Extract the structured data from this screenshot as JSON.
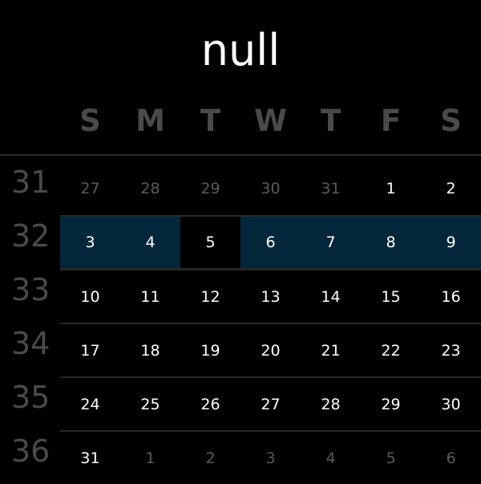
{
  "calendar": {
    "title": "null",
    "weekdays": [
      "S",
      "M",
      "T",
      "W",
      "T",
      "F",
      "S"
    ],
    "weeks": [
      {
        "week_number": "31",
        "days": [
          {
            "label": "27",
            "other_month": true
          },
          {
            "label": "28",
            "other_month": true
          },
          {
            "label": "29",
            "other_month": true
          },
          {
            "label": "30",
            "other_month": true
          },
          {
            "label": "31",
            "other_month": true
          },
          {
            "label": "1",
            "other_month": false
          },
          {
            "label": "2",
            "other_month": false
          }
        ]
      },
      {
        "week_number": "32",
        "selected": true,
        "days": [
          {
            "label": "3",
            "other_month": false
          },
          {
            "label": "4",
            "other_month": false
          },
          {
            "label": "5",
            "other_month": false,
            "today": true
          },
          {
            "label": "6",
            "other_month": false
          },
          {
            "label": "7",
            "other_month": false
          },
          {
            "label": "8",
            "other_month": false
          },
          {
            "label": "9",
            "other_month": false
          }
        ]
      },
      {
        "week_number": "33",
        "days": [
          {
            "label": "10",
            "other_month": false
          },
          {
            "label": "11",
            "other_month": false
          },
          {
            "label": "12",
            "other_month": false
          },
          {
            "label": "13",
            "other_month": false
          },
          {
            "label": "14",
            "other_month": false
          },
          {
            "label": "15",
            "other_month": false
          },
          {
            "label": "16",
            "other_month": false
          }
        ]
      },
      {
        "week_number": "34",
        "days": [
          {
            "label": "17",
            "other_month": false
          },
          {
            "label": "18",
            "other_month": false
          },
          {
            "label": "19",
            "other_month": false
          },
          {
            "label": "20",
            "other_month": false
          },
          {
            "label": "21",
            "other_month": false
          },
          {
            "label": "22",
            "other_month": false
          },
          {
            "label": "23",
            "other_month": false
          }
        ]
      },
      {
        "week_number": "35",
        "days": [
          {
            "label": "24",
            "other_month": false
          },
          {
            "label": "25",
            "other_month": false
          },
          {
            "label": "26",
            "other_month": false
          },
          {
            "label": "27",
            "other_month": false
          },
          {
            "label": "28",
            "other_month": false
          },
          {
            "label": "29",
            "other_month": false
          },
          {
            "label": "30",
            "other_month": false
          }
        ]
      },
      {
        "week_number": "36",
        "days": [
          {
            "label": "31",
            "other_month": false
          },
          {
            "label": "1",
            "other_month": true
          },
          {
            "label": "2",
            "other_month": true
          },
          {
            "label": "3",
            "other_month": true
          },
          {
            "label": "4",
            "other_month": true
          },
          {
            "label": "5",
            "other_month": true
          },
          {
            "label": "6",
            "other_month": true
          }
        ]
      }
    ]
  },
  "colors": {
    "background": "#000000",
    "selected_week": "#04263a",
    "weekday_header": "#4a4a4a",
    "other_month_day": "#5a5a5a",
    "current_month_day": "#ffffff"
  }
}
